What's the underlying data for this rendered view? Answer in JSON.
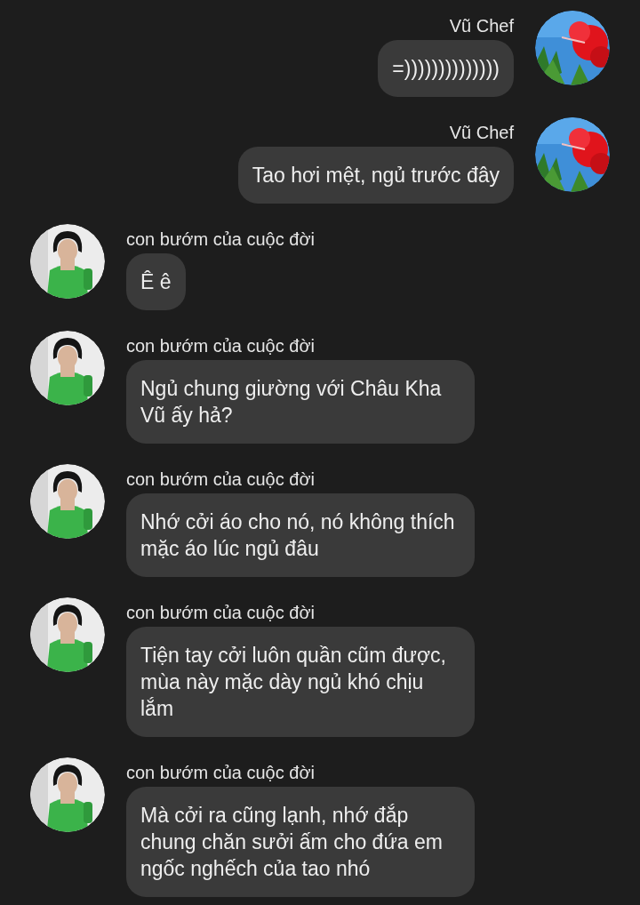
{
  "messages": [
    {
      "kind": "outgoing",
      "sender": "Vũ Chef",
      "text": "=))))))))))))))"
    },
    {
      "kind": "outgoing",
      "sender": "Vũ Chef",
      "text": "Tao hơi mệt, ngủ trước đây"
    },
    {
      "kind": "incoming",
      "sender": "con bướm của cuộc đời",
      "text": "Ê ê"
    },
    {
      "kind": "incoming",
      "sender": "con bướm của cuộc đời",
      "text": "Ngủ chung giường với Châu Kha Vũ ấy hả?"
    },
    {
      "kind": "incoming",
      "sender": "con bướm của cuộc đời",
      "text": "Nhớ cởi áo cho nó, nó không thích mặc áo lúc ngủ đâu"
    },
    {
      "kind": "incoming",
      "sender": "con bướm của cuộc đời",
      "text": "Tiện tay cởi luôn quần cũm được, mùa này mặc dày ngủ khó chịu lắm"
    },
    {
      "kind": "incoming",
      "sender": "con bướm của cuộc đời",
      "text": "Mà cởi ra cũng lạnh, nhớ đắp chung chăn sưởi ấm cho đứa em ngốc nghếch của tao nhó"
    }
  ]
}
